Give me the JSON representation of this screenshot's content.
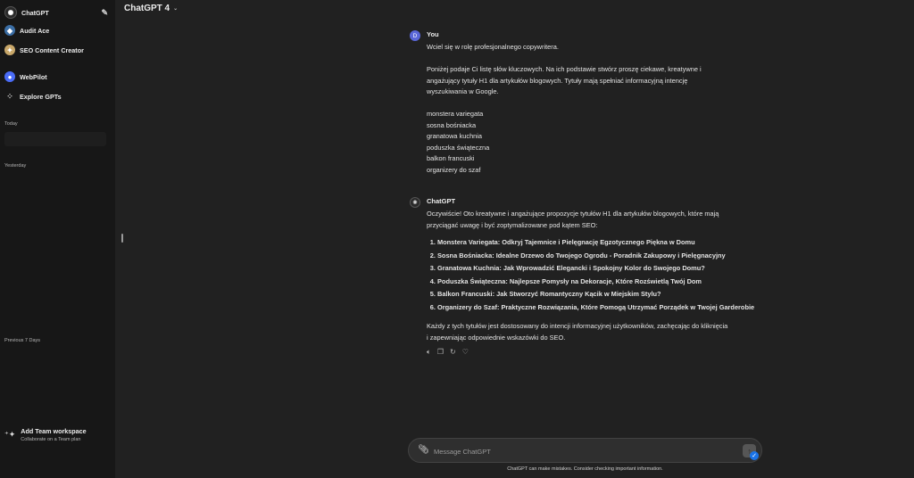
{
  "sidebar": {
    "items": [
      {
        "label": "ChatGPT",
        "icon": "chatgpt-logo-icon"
      },
      {
        "label": "Audit Ace",
        "icon": "audit-ace-icon"
      },
      {
        "label": "SEO Content Creator",
        "icon": "seo-content-creator-icon"
      },
      {
        "label": "WebPilot",
        "icon": "webpilot-icon"
      },
      {
        "label": "Explore GPTs",
        "icon": "grid-icon"
      }
    ],
    "sections": {
      "today": "Today",
      "yesterday": "Yesterday",
      "previous7": "Previous 7 Days"
    },
    "team": {
      "title": "Add Team workspace",
      "subtitle": "Collaborate on a Team plan"
    }
  },
  "header": {
    "model": "ChatGPT 4"
  },
  "conversation": {
    "user": {
      "author": "You",
      "avatar_letter": "D",
      "lines": [
        "Wciel się w rolę profesjonalnego copywritera.",
        "",
        "Poniżej podaje Ci listę słów kluczowych. Na ich podstawie stwórz proszę ciekawe, kreatywne i",
        "angażujący tytuły H1 dla artykułów blogowych. Tytuły mają spełniać informacyjną intencję",
        "wyszukiwania w Google.",
        "",
        "monstera variegata",
        "sosna bośniacka",
        "granatowa kuchnia",
        "poduszka świąteczna",
        "balkon francuski",
        "organizery do szaf"
      ]
    },
    "assistant": {
      "author": "ChatGPT",
      "intro": [
        "Oczywiście! Oto kreatywne i angażujące propozycje tytułów H1 dla artykułów blogowych, które mają",
        "przyciągać uwagę i być zoptymalizowane pod kątem SEO:"
      ],
      "titles": [
        "Monstera Variegata: Odkryj Tajemnice i Pielęgnację Egzotycznego Piękna w Domu",
        "Sosna Bośniacka: Idealne Drzewo do Twojego Ogrodu - Poradnik Zakupowy i Pielęgnacyjny",
        "Granatowa Kuchnia: Jak Wprowadzić Elegancki i Spokojny Kolor do Swojego Domu?",
        "Poduszka Świąteczna: Najlepsze Pomysły na Dekoracje, Które Rozświetlą Twój Dom",
        "Balkon Francuski: Jak Stworzyć Romantyczny Kącik w Miejskim Stylu?",
        "Organizery do Szaf: Praktyczne Rozwiązania, Które Pomogą Utrzymać Porządek w Twojej Garderobie"
      ],
      "outro": [
        "Każdy z tych tytułów jest dostosowany do intencji informacyjnej użytkowników, zachęcając do kliknięcia",
        "i zapewniając odpowiednie wskazówki do SEO."
      ]
    }
  },
  "composer": {
    "placeholder": "Message ChatGPT"
  },
  "disclaimer": "ChatGPT can make mistakes. Consider checking important information.",
  "colors": {
    "background": "#212121",
    "sidebar": "#171717",
    "user_avatar": "#5a67d8",
    "badge": "#1a73e8"
  }
}
